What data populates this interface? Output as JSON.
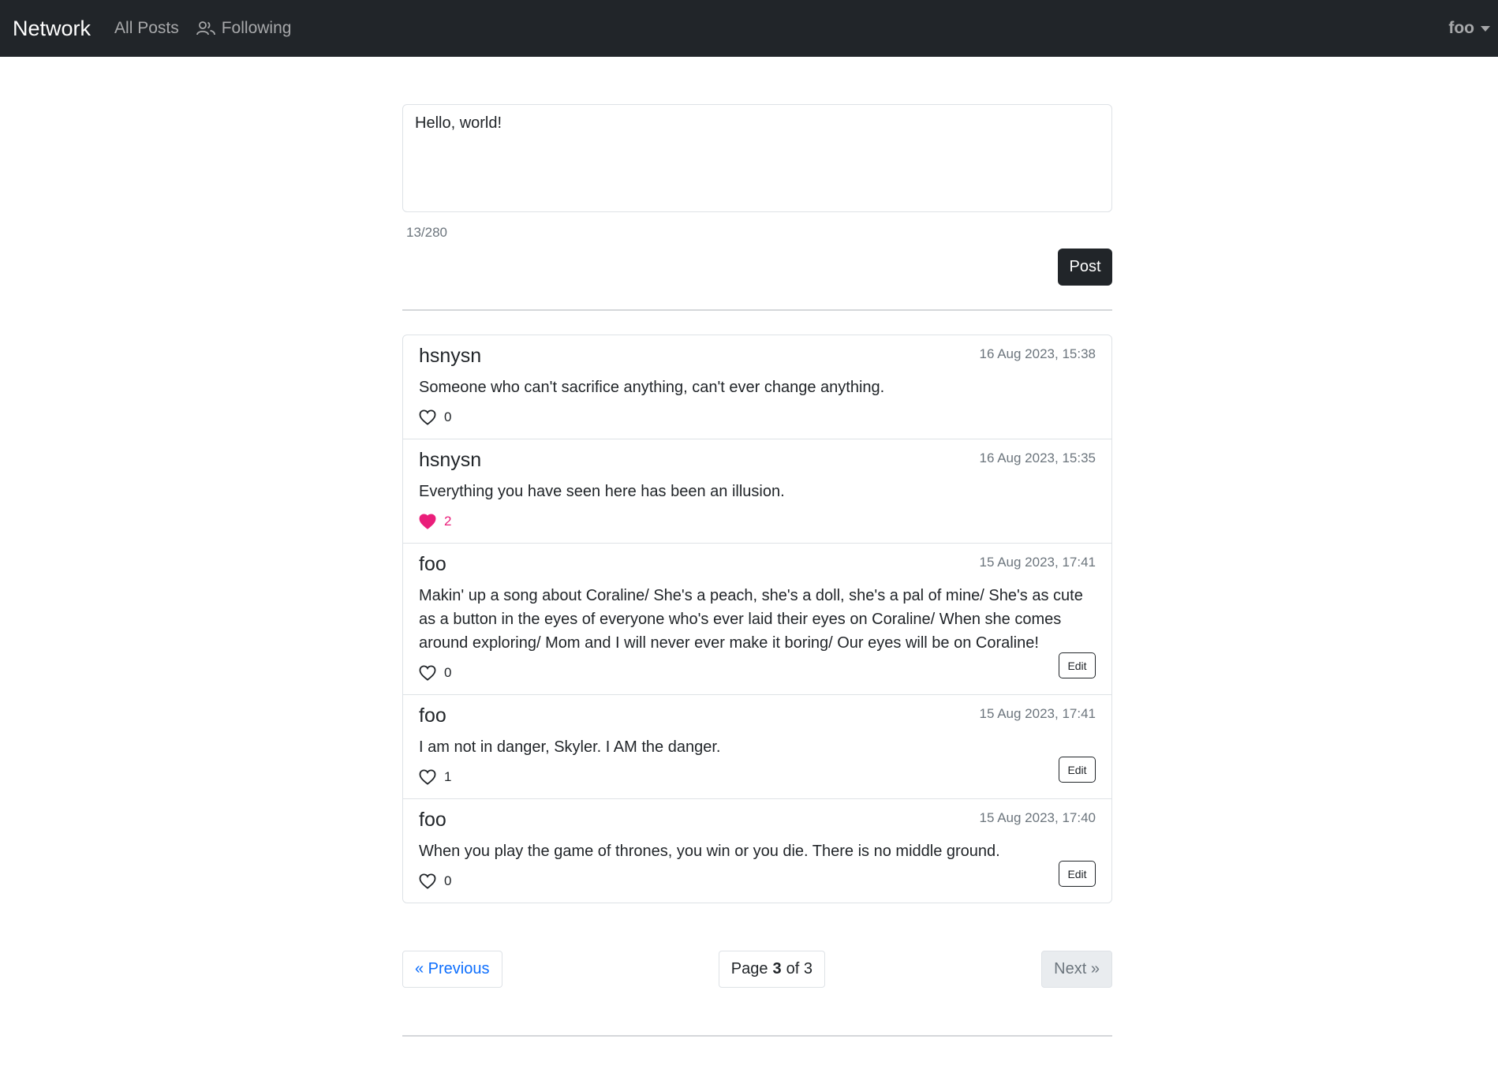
{
  "navbar": {
    "brand": "Network",
    "all_posts": "All Posts",
    "following": "Following",
    "user": "foo"
  },
  "composer": {
    "value": "Hello, world!",
    "counter": "13/280",
    "post_label": "Post"
  },
  "posts": [
    {
      "author": "hsnysn",
      "timestamp": "16 Aug 2023, 15:38",
      "content": "Someone who can't sacrifice anything, can't ever change anything.",
      "likes": "0",
      "liked": false,
      "editable": false
    },
    {
      "author": "hsnysn",
      "timestamp": "16 Aug 2023, 15:35",
      "content": "Everything you have seen here has been an illusion.",
      "likes": "2",
      "liked": true,
      "editable": false
    },
    {
      "author": "foo",
      "timestamp": "15 Aug 2023, 17:41",
      "content": "Makin' up a song about Coraline/ She's a peach, she's a doll, she's a pal of mine/ She's as cute as a button in the eyes of everyone who's ever laid their eyes on Coraline/ When she comes around exploring/ Mom and I will never ever make it boring/ Our eyes will be on Coraline!",
      "likes": "0",
      "liked": false,
      "editable": true,
      "edit_label": "Edit"
    },
    {
      "author": "foo",
      "timestamp": "15 Aug 2023, 17:41",
      "content": "I am not in danger, Skyler. I AM the danger.",
      "likes": "1",
      "liked": false,
      "editable": true,
      "edit_label": "Edit"
    },
    {
      "author": "foo",
      "timestamp": "15 Aug 2023, 17:40",
      "content": "When you play the game of thrones, you win or you die. There is no middle ground.",
      "likes": "0",
      "liked": false,
      "editable": true,
      "edit_label": "Edit"
    }
  ],
  "pagination": {
    "previous": "« Previous",
    "page_prefix": "Page",
    "current": "3",
    "of_label": "of 3",
    "next": "Next »"
  },
  "colors": {
    "navbar_bg": "#212529",
    "liked_heart": "#ea1e7a",
    "link": "#0d6efd"
  },
  "icons": {
    "following": "people-icon",
    "like_empty": "heart-outline-icon",
    "like_filled": "heart-filled-icon",
    "user_menu": "caret-down-icon"
  }
}
